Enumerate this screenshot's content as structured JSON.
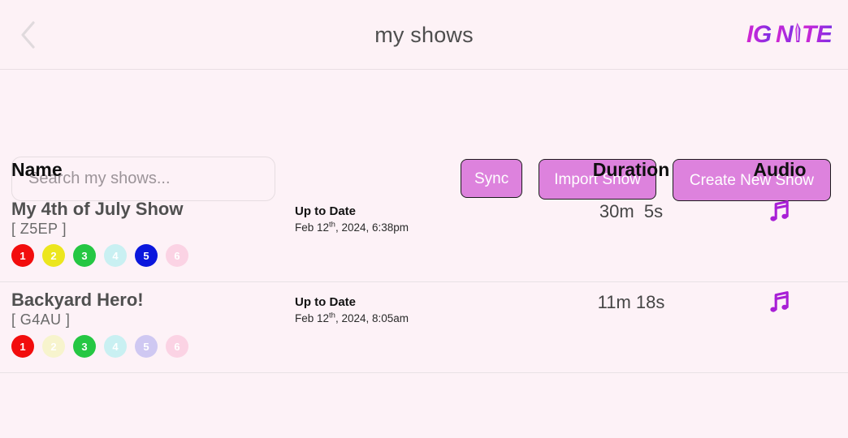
{
  "header": {
    "title": "my shows",
    "back_icon": "chevron-left-icon",
    "logo_text": "IGNITE",
    "logo_colors": {
      "start": "#cc2bd8",
      "end": "#7b2fe0"
    }
  },
  "toolbar": {
    "search_placeholder": "Search my shows...",
    "search_value": "",
    "buttons": [
      {
        "label": "Sync",
        "name": "sync-button"
      },
      {
        "label": "Import Show",
        "name": "import-show-button"
      },
      {
        "label": "Create New Show",
        "name": "create-new-show-button"
      }
    ],
    "button_color": "#dd82dd"
  },
  "table": {
    "columns": [
      "Name",
      "Duration",
      "Audio"
    ],
    "rows": [
      {
        "title": "My 4th of July Show",
        "code": "[ Z5EP ]",
        "status": "Up to Date",
        "date_month_day": "Feb 12",
        "date_ordinal": "th",
        "date_rest": ", 2024, 6:38pm",
        "duration": "30m  5s",
        "audio_icon": "music-note-icon",
        "audio_icon_color": "#a81fd6",
        "chips": [
          {
            "label": "1",
            "color": "#f20d0d",
            "text_color": "#ffffff"
          },
          {
            "label": "2",
            "color": "#ece61e",
            "text_color": "#ffffff"
          },
          {
            "label": "3",
            "color": "#25c743",
            "text_color": "#ffffff"
          },
          {
            "label": "4",
            "color": "#c9f0f2",
            "text_color": "#ffffff"
          },
          {
            "label": "5",
            "color": "#0b17dd",
            "text_color": "#ffffff"
          },
          {
            "label": "6",
            "color": "#fbd3e4",
            "text_color": "#ffffff"
          }
        ]
      },
      {
        "title": "Backyard Hero!",
        "code": "[ G4AU ]",
        "status": "Up to Date",
        "date_month_day": "Feb 12",
        "date_ordinal": "th",
        "date_rest": ", 2024, 8:05am",
        "duration": "11m 18s",
        "audio_icon": "music-note-icon",
        "audio_icon_color": "#a81fd6",
        "chips": [
          {
            "label": "1",
            "color": "#f20d0d",
            "text_color": "#ffffff"
          },
          {
            "label": "2",
            "color": "#f7f4cd",
            "text_color": "#ffffff"
          },
          {
            "label": "3",
            "color": "#25c743",
            "text_color": "#ffffff"
          },
          {
            "label": "4",
            "color": "#c9f0f2",
            "text_color": "#ffffff"
          },
          {
            "label": "5",
            "color": "#cfc8f2",
            "text_color": "#ffffff"
          },
          {
            "label": "6",
            "color": "#fbd3e4",
            "text_color": "#ffffff"
          }
        ]
      }
    ]
  },
  "theme": {
    "page_background": "#fdf2f7",
    "header_background": "#fdf2f6"
  }
}
